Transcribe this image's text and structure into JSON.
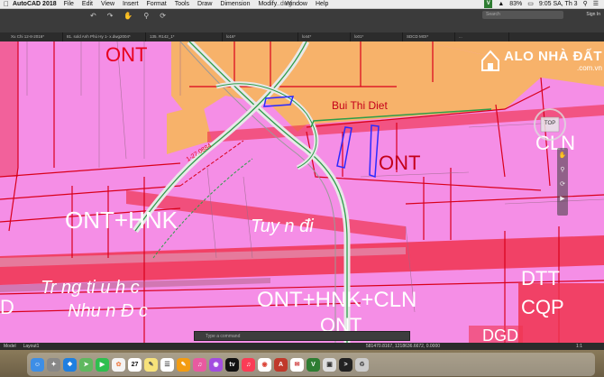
{
  "menubar": {
    "app_name": "AutoCAD 2018",
    "items": [
      "File",
      "Edit",
      "View",
      "Insert",
      "Format",
      "Tools",
      "Draw",
      "Dimension",
      "Modify",
      "Window",
      "Help"
    ],
    "document_title": "...dwg",
    "battery": "83%",
    "clock": "9:05 SA, Th 3"
  },
  "toolbar": {
    "search_placeholder": "Search",
    "sign_in": "Sign In"
  },
  "tabs": [
    "Xu Chi 12-8-2016*",
    "81. sold Anh Phú Hy 1- x.dwg2004*",
    "135. R142_1*",
    "lo16*",
    "lo44*",
    "lo01*",
    "SDCD MOI*",
    "..."
  ],
  "drawing": {
    "labels": {
      "ont_top": "ONT",
      "owner": "Bui Thi Diet",
      "cln": "CLN",
      "ont_mid": "ONT",
      "ont_hnk": "ONT+HNK",
      "road": "Tuy n đi",
      "school_1": "Tr ng ti u h c",
      "school_2": "Nhu n Đ c",
      "ont_hnk_cln": "ONT+HNK+CLN",
      "ont_bottom": "ONT",
      "dtt": "DTT",
      "cqp": "CQP",
      "dgd": "DGD",
      "d_left": "D",
      "dim_text": "1-27.0884"
    },
    "viewcube_label": "TOP",
    "colors": {
      "ont_pink": "#f58ee6",
      "orange_parcel": "#f7b26a",
      "road_red": "#f0344f",
      "boundary_red": "#d9001b",
      "outline_green": "#2e9d4a"
    }
  },
  "watermark": {
    "title": "ALO NHÀ ĐẤT",
    "sub": ".com.vn"
  },
  "command_line": {
    "placeholder": "Type a command"
  },
  "statusbar": {
    "model_tab": "Model",
    "layout_tab": "Layout1",
    "coordinates": "581470.8167, 1218636.6672, 0.0000",
    "scale": "1:1"
  },
  "dock": {
    "apps": [
      "finder",
      "launchpad",
      "safari",
      "maps",
      "facetime",
      "photos",
      "calendar",
      "notes",
      "reminders",
      "pages",
      "itunes",
      "podcasts",
      "appletv",
      "music",
      "chrome",
      "autocad",
      "mail",
      "vbox",
      "preview",
      "terminal",
      "trash"
    ]
  }
}
